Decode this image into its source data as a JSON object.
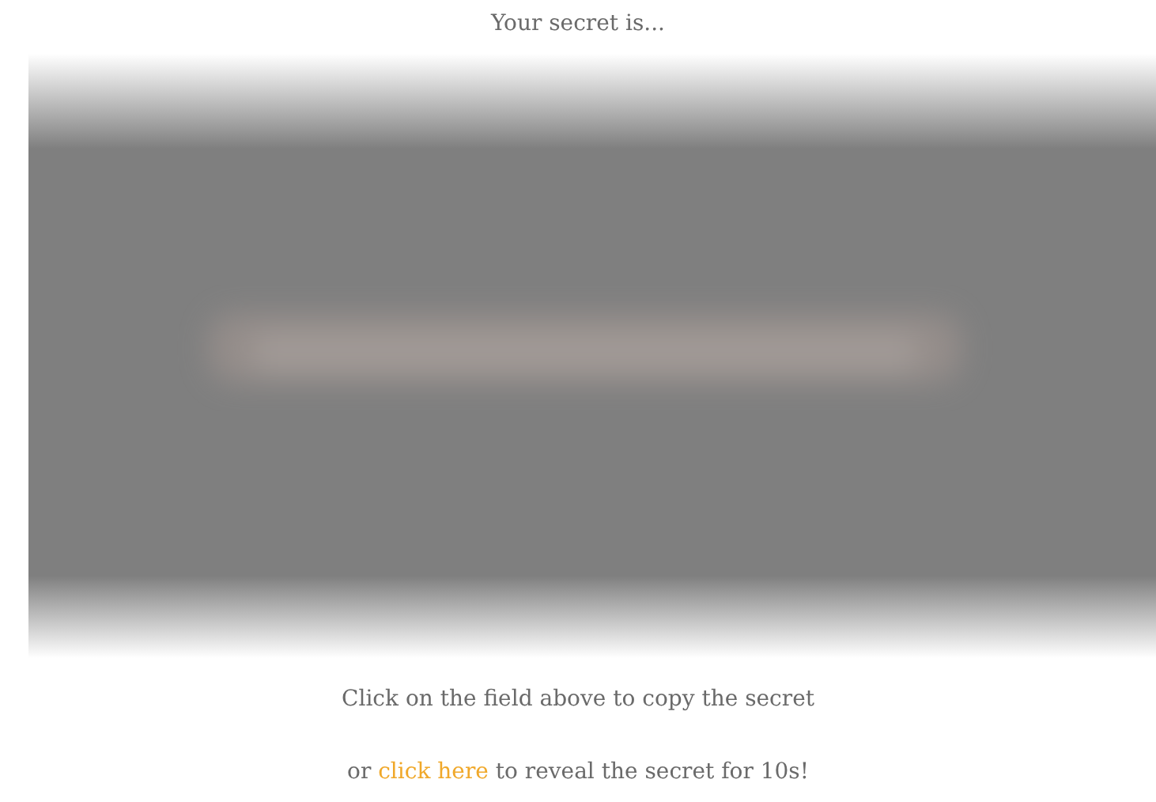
{
  "heading": "Your secret is...",
  "secret_field": {
    "concealed": true
  },
  "copy_hint": "Click on the field above to copy the secret",
  "reveal_line": {
    "before": "or",
    "link": "click here",
    "after": "to reveal the secret for 10s!"
  }
}
